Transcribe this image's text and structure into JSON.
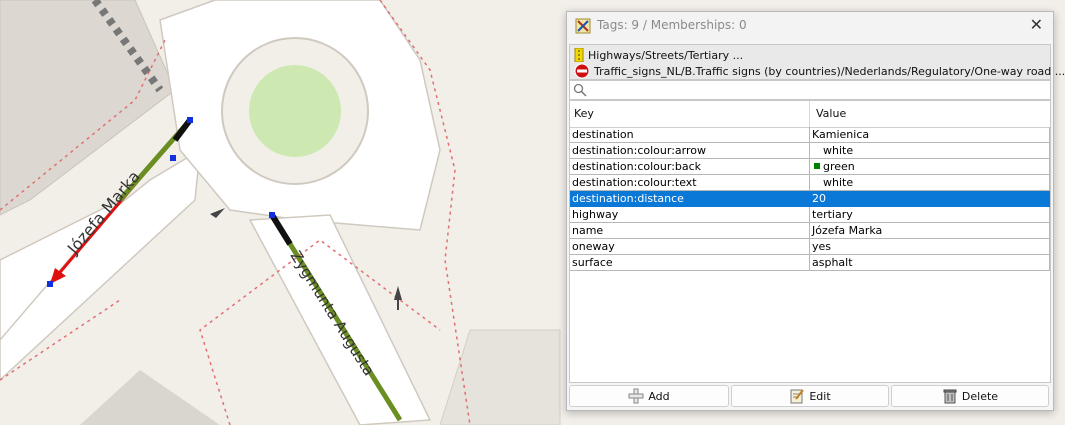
{
  "dialog": {
    "title": "Tags: 9 / Memberships: 0",
    "close_label": "✕"
  },
  "presets": [
    {
      "icon": "road-sign-icon",
      "label": "Highways/Streets/Tertiary ..."
    },
    {
      "icon": "no-entry-sign-icon",
      "label": "Traffic_signs_NL/B.Traffic signs (by countries)/Nederlands/Regulatory/One-way road ..."
    }
  ],
  "search": {
    "value": "",
    "placeholder": ""
  },
  "table": {
    "headers": {
      "key": "Key",
      "value": "Value"
    },
    "rows": [
      {
        "key": "destination",
        "value": "Kamienica"
      },
      {
        "key": "destination:colour:arrow",
        "value": "white",
        "swatch": "#ffffff"
      },
      {
        "key": "destination:colour:back",
        "value": "green",
        "swatch": "#008000"
      },
      {
        "key": "destination:colour:text",
        "value": "white",
        "swatch": "#ffffff"
      },
      {
        "key": "destination:distance",
        "value": "20",
        "selected": true
      },
      {
        "key": "highway",
        "value": "tertiary"
      },
      {
        "key": "name",
        "value": "Józefa Marka"
      },
      {
        "key": "oneway",
        "value": "yes"
      },
      {
        "key": "surface",
        "value": "asphalt"
      }
    ]
  },
  "buttons": {
    "add": "Add",
    "edit": "Edit",
    "delete": "Delete"
  },
  "map": {
    "labels": {
      "street_a": "Józefa Marka",
      "street_b": "Zygmunta Augusta"
    }
  },
  "colors": {
    "selection": "#0a78d7",
    "road_highlight": "#6b8e23",
    "selected_way": "#e01010",
    "roundabout_center": "#cde8b0"
  }
}
